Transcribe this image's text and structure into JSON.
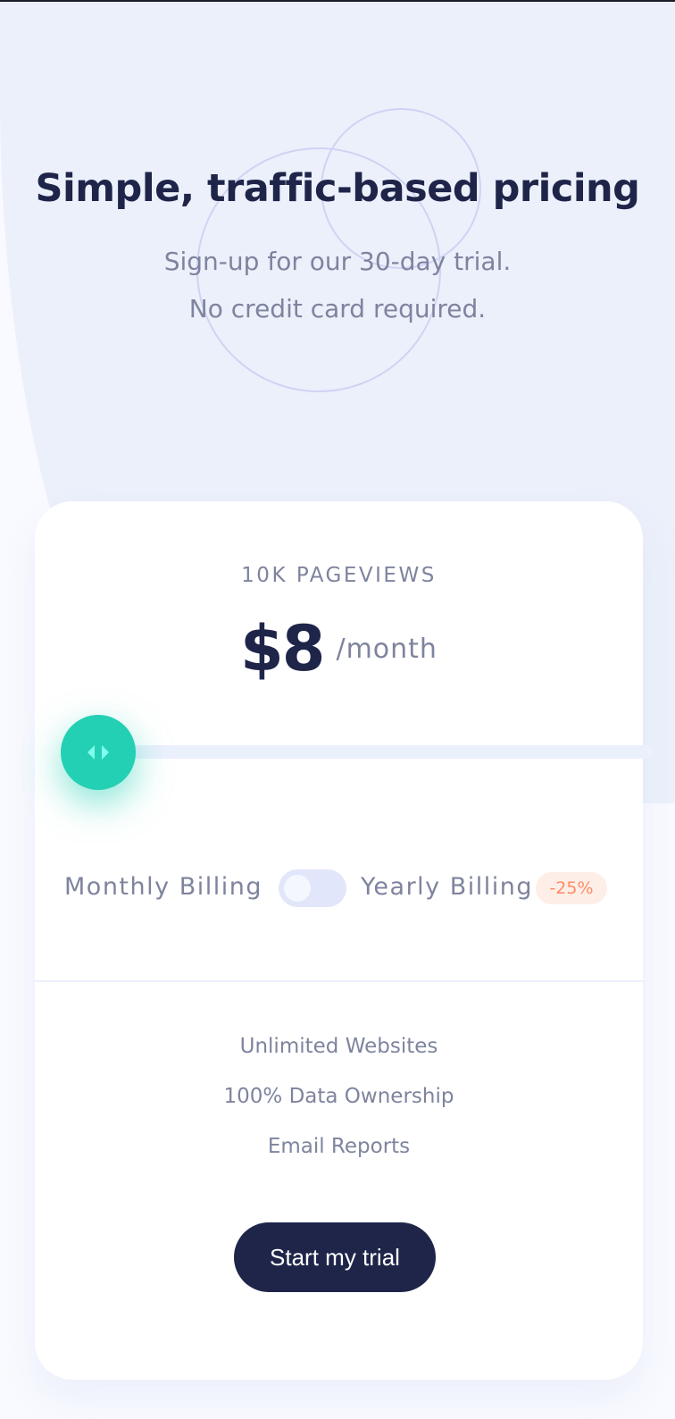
{
  "hero": {
    "title": "Simple, traffic-based pricing",
    "subtitle_line1": "Sign-up for our 30-day trial.",
    "subtitle_line2": "No credit card required."
  },
  "pricing": {
    "pageviews": "10K PAGEVIEWS",
    "price": "$8",
    "period": "/month",
    "slider_level_fraction": 0.0,
    "slider_icon": "left-right-arrows-icon"
  },
  "billing": {
    "monthly_label": "Monthly Billing",
    "yearly_label": "Yearly Billing",
    "yearly_enabled": false,
    "discount": "-25%"
  },
  "features": [
    "Unlimited Websites",
    "100% Data Ownership",
    "Email Reports"
  ],
  "cta": {
    "label": "Start my trial"
  },
  "colors": {
    "primary_dark": "#1e2549",
    "grayish_blue": "#7e849e",
    "accent_teal": "#23d0b3",
    "slider_track": "#ebf0fd",
    "discount_text": "#ff8c66",
    "discount_bg": "#fdeee7",
    "page_band": "#ecf0fb"
  }
}
